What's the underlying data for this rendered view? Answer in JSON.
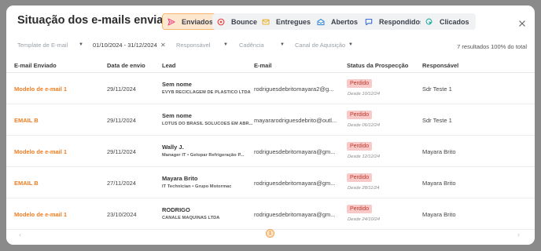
{
  "modal": {
    "title": "Situação dos e-mails enviados",
    "tabs": [
      {
        "label": "Enviados",
        "icon": "send-icon",
        "color": "#e94a8a"
      },
      {
        "label": "Bounce",
        "icon": "bounce-icon",
        "color": "#e84a4a"
      },
      {
        "label": "Entregues",
        "icon": "envelope-icon",
        "color": "#e9b12c"
      },
      {
        "label": "Abertos",
        "icon": "open-envelope-icon",
        "color": "#3a8fd8"
      },
      {
        "label": "Respondidos",
        "icon": "reply-icon",
        "color": "#3a6fd8"
      },
      {
        "label": "Clicados",
        "icon": "click-icon",
        "color": "#2bb0a8"
      }
    ],
    "close_icon": "close-icon"
  },
  "filters": {
    "template_placeholder": "Template de E-mail",
    "date_range": "01/10/2024 - 31/12/2024",
    "responsavel_placeholder": "Responsável",
    "cadencia_placeholder": "Cadência",
    "canal_placeholder": "Canal de Aquisição",
    "results": "7 resultados",
    "total": "100% do total"
  },
  "table": {
    "headers": [
      "E-mail Enviado",
      "Data de envio",
      "Lead",
      "E-mail",
      "Status da Prospecção",
      "Responsável"
    ],
    "rows": [
      {
        "email_sent": "Modelo de e-mail 1",
        "date": "29/11/2024",
        "lead_name": "Sem nome",
        "lead_sub": "EVYB RECICLAGEM DE PLASTICO LTDA",
        "email": "rodriguesdebritomayara2@g...",
        "status": "Perdido",
        "since": "Desde 10/12/24",
        "owner": "Sdr Teste 1"
      },
      {
        "email_sent": "EMAIL B",
        "date": "29/11/2024",
        "lead_name": "Sem nome",
        "lead_sub": "LOTUS DO BRASIL SOLUCOES EM ABR...",
        "email": "mayararodriguesdebrito@outl...",
        "status": "Perdido",
        "since": "Desde 06/12/24",
        "owner": "Sdr Teste 1"
      },
      {
        "email_sent": "Modelo de e-mail 1",
        "date": "29/11/2024",
        "lead_name": "Wally J.",
        "lead_sub": "Manager IT • Gelopar Refrigeração P...",
        "email": "rodriguesdebritomayara@gm...",
        "status": "Perdido",
        "since": "Desde 12/12/24",
        "owner": "Mayara Brito"
      },
      {
        "email_sent": "EMAIL B",
        "date": "27/11/2024",
        "lead_name": "Mayara Brito",
        "lead_sub": "IT Technician • Grupo Motormac",
        "email": "rodriguesdebritomayara@gm...",
        "status": "Perdido",
        "since": "Desde 28/11/24",
        "owner": "Mayara Brito"
      },
      {
        "email_sent": "Modelo de e-mail 1",
        "date": "23/10/2024",
        "lead_name": "RODRIGO",
        "lead_sub": "CANALE MAQUINAS LTDA",
        "email": "rodriguesdebritomayara@gm...",
        "status": "Perdido",
        "since": "Desde 24/10/24",
        "owner": "Mayara Brito"
      }
    ]
  },
  "pagination": {
    "current": "1",
    "prev_icon": "chevron-left-icon",
    "next_icon": "chevron-right-icon"
  }
}
